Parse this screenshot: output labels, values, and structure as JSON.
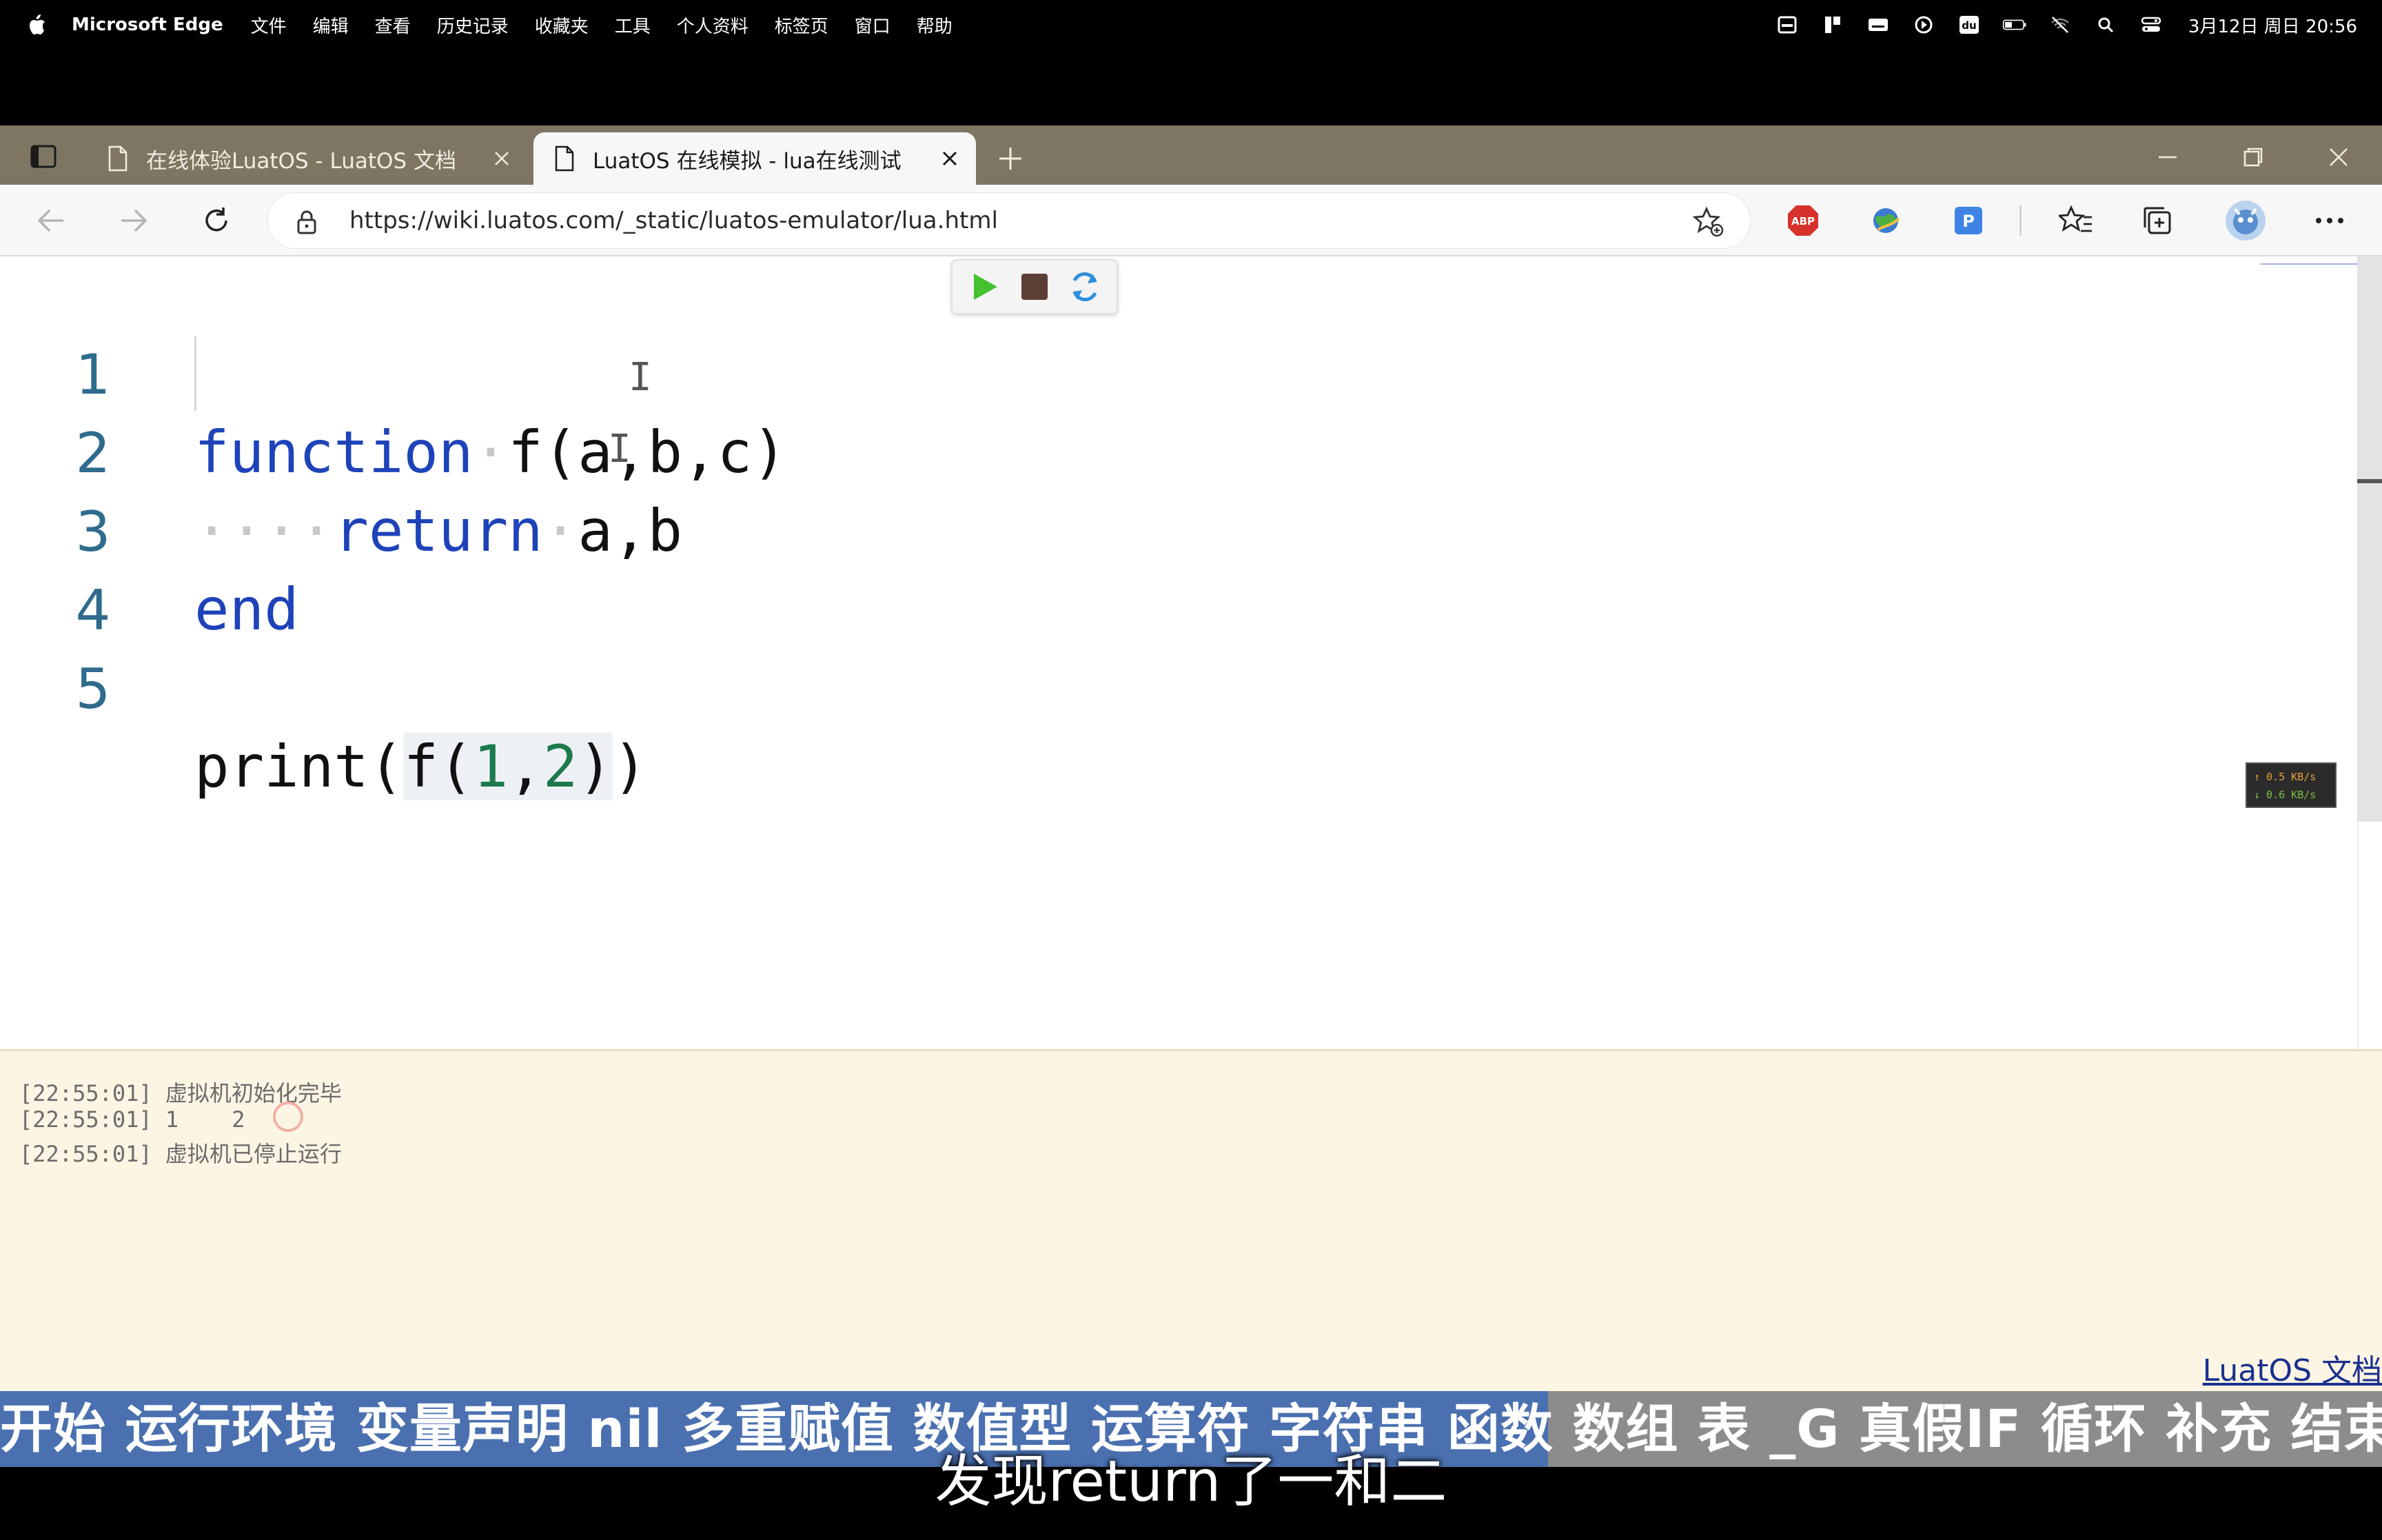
{
  "menubar": {
    "app_name": "Microsoft Edge",
    "items": [
      "文件",
      "编辑",
      "查看",
      "历史记录",
      "收藏夹",
      "工具",
      "个人资料",
      "标签页",
      "窗口",
      "帮助"
    ],
    "clock": "3月12日 周日 20:56"
  },
  "tabs": [
    {
      "title": "在线体验LuatOS - LuatOS 文档",
      "active": false
    },
    {
      "title": "LuatOS 在线模拟 - lua在线测试",
      "active": true
    }
  ],
  "address_bar": {
    "url": "https://wiki.luatos.com/_static/luatos-emulator/lua.html"
  },
  "editor": {
    "lines": [
      {
        "no": "1",
        "text": "function f(a,b,c)"
      },
      {
        "no": "2",
        "text": "    return a,b"
      },
      {
        "no": "3",
        "text": "end"
      },
      {
        "no": "4",
        "text": ""
      },
      {
        "no": "5",
        "text": "print(f(1,2))"
      }
    ]
  },
  "net_widget": {
    "up": "↑ 0.5 KB/s",
    "down": "↓ 0.6 KB/s"
  },
  "console": {
    "logs": [
      "[22:55:01] 虚拟机初始化完毕",
      "[22:55:01] 1    2",
      "[22:55:01] 虚拟机已停止运行"
    ],
    "docs_link": "LuatOS 文档"
  },
  "video": {
    "chapters": "开始 运行环境 变量声明 nil 多重赋值 数值型 运算符 字符串 函数 数组 表 _G 真假IF 循环 补充 结束",
    "progress": 0.65,
    "subtitle": "发现return了一和二"
  },
  "colors": {
    "keyword": "#1e43b9",
    "number": "#1d7a4c",
    "tabstrip": "#7e7663",
    "console_bg": "#fdf5e4",
    "chapter_progress": "#4a70b0"
  }
}
